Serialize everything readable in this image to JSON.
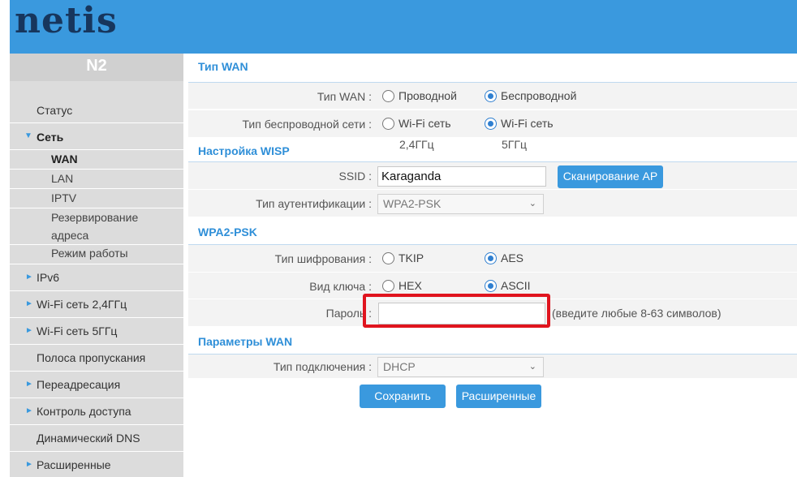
{
  "header": {
    "logo": "netis"
  },
  "sidebar": {
    "model": "N2",
    "items": [
      {
        "label": "Статус",
        "arrow": ""
      },
      {
        "label": "Сеть",
        "arrow": "▼"
      },
      {
        "label": "IPv6",
        "arrow": "►"
      },
      {
        "label": "Wi-Fi сеть 2,4ГГц",
        "arrow": "►"
      },
      {
        "label": "Wi-Fi сеть 5ГГц",
        "arrow": "►"
      },
      {
        "label": "Полоса пропускания",
        "arrow": ""
      },
      {
        "label": "Переадресация",
        "arrow": "►"
      },
      {
        "label": "Контроль доступа",
        "arrow": "►"
      },
      {
        "label": "Динамический DNS",
        "arrow": ""
      },
      {
        "label": "Расширенные",
        "arrow": "►"
      }
    ],
    "subitems": [
      {
        "label": "WAN"
      },
      {
        "label": "LAN"
      },
      {
        "label": "IPTV"
      },
      {
        "label": "Резервирование адреса"
      },
      {
        "label": "Режим работы"
      }
    ]
  },
  "main": {
    "sections": {
      "wan_type": "Тип WAN",
      "wisp": "Настройка WISP",
      "wpa": "WPA2-PSK",
      "wan_params": "Параметры WAN"
    },
    "wan_type": {
      "label": "Тип WAN :",
      "options": [
        "Проводной",
        "Беспроводной"
      ],
      "selected": "Беспроводной"
    },
    "wireless_type": {
      "label": "Тип беспроводной сети :",
      "options": [
        "Wi-Fi сеть",
        "Wi-Fi сеть"
      ],
      "captions": [
        "2,4ГГц",
        "5ГГц"
      ],
      "selected_index": 1
    },
    "ssid": {
      "label": "SSID :",
      "value": "Karaganda",
      "scan_button": "Сканирование AP"
    },
    "auth": {
      "label": "Тип аутентификации :",
      "value": "WPA2-PSK"
    },
    "encryption": {
      "label": "Тип шифрования :",
      "options": [
        "TKIP",
        "AES"
      ],
      "selected": "AES"
    },
    "key_type": {
      "label": "Вид ключа :",
      "options": [
        "HEX",
        "ASCII"
      ],
      "selected": "ASCII"
    },
    "password": {
      "label": "Пароль :",
      "value": "",
      "hint": "(введите любые 8-63 символов)"
    },
    "connection": {
      "label": "Тип подключения :",
      "value": "DHCP"
    },
    "buttons": {
      "save": "Сохранить",
      "advanced": "Расширенные"
    }
  },
  "colors": {
    "header": "#3a99de",
    "accent": "#2f8fd8",
    "highlight": "#e0141e"
  }
}
